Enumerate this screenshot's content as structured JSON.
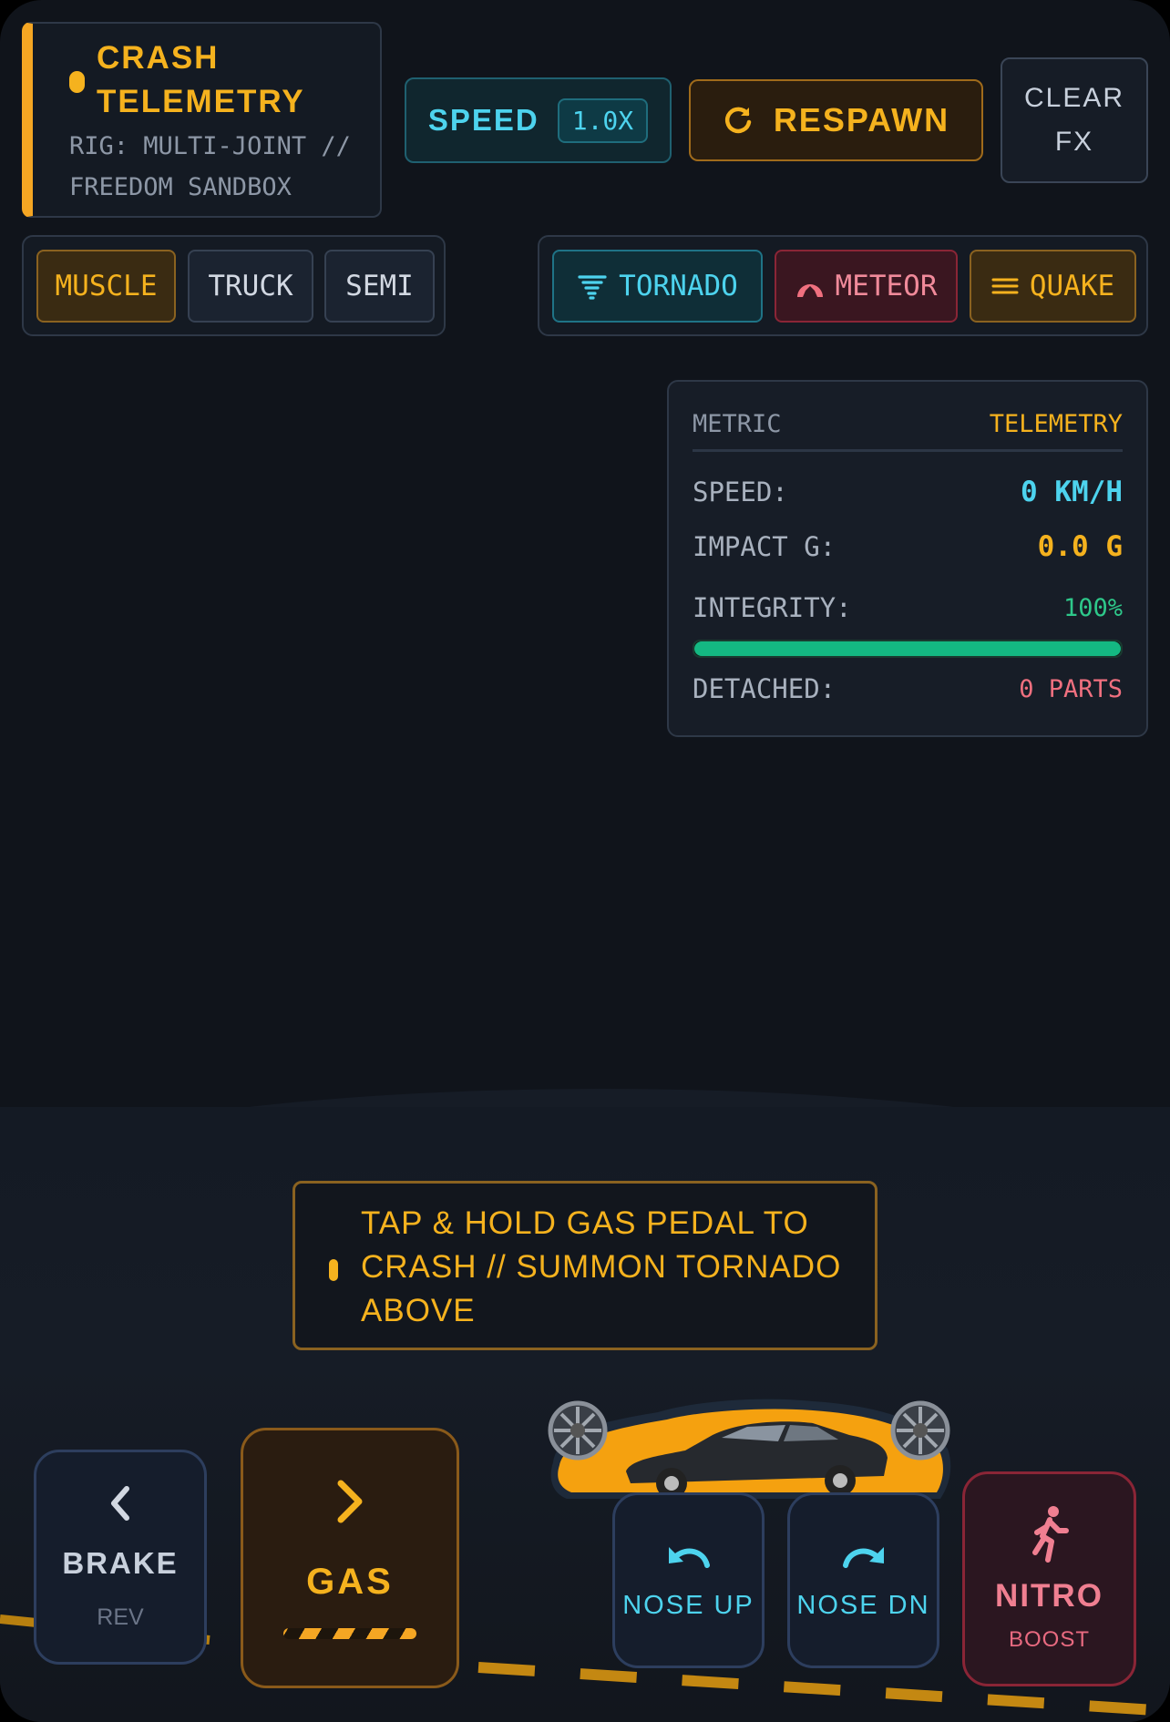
{
  "header": {
    "title": "CRASH TELEMETRY",
    "subtitle": "RIG: MULTI-JOINT // FREEDOM SANDBOX"
  },
  "toolbar": {
    "speed_label": "SPEED",
    "speed_value": "1.0X",
    "respawn_label": "RESPAWN",
    "respawn_icon": "refresh-icon",
    "clear_line1": "CLEAR",
    "clear_line2": "FX"
  },
  "vehicles": {
    "selected": "MUSCLE",
    "items": [
      "MUSCLE",
      "TRUCK",
      "SEMI"
    ]
  },
  "hazards": [
    {
      "label": "TORNADO",
      "icon": "tornado-icon",
      "color": "#4dd3ee"
    },
    {
      "label": "METEOR",
      "icon": "meteor-icon",
      "color": "#f0707f"
    },
    {
      "label": "QUAKE",
      "icon": "quake-icon",
      "color": "#f5b21e"
    }
  ],
  "telemetry": {
    "header_key": "METRIC",
    "header_value": "TELEMETRY",
    "speed_key": "SPEED:",
    "speed_value": "0 KM/H",
    "impact_key": "IMPACT G:",
    "impact_value": "0.0 G",
    "integrity_key": "INTEGRITY:",
    "integrity_value": "100%",
    "integrity_fraction": 1.0,
    "detached_key": "DETACHED:",
    "detached_value": "0 PARTS"
  },
  "hint": {
    "text": "TAP & HOLD GAS PEDAL TO CRASH // SUMMON TORNADO ABOVE"
  },
  "controls": {
    "brake_label": "BRAKE",
    "brake_sub": "REV",
    "gas_label": "GAS",
    "nose_up_label": "NOSE UP",
    "nose_dn_label": "NOSE DN",
    "nitro_label": "NITRO",
    "nitro_sub": "BOOST"
  },
  "colors": {
    "accent": "#f5b21e",
    "cyan": "#4dd3ee",
    "danger": "#f0707f",
    "integrity": "#14b882",
    "background": "#10141b"
  }
}
